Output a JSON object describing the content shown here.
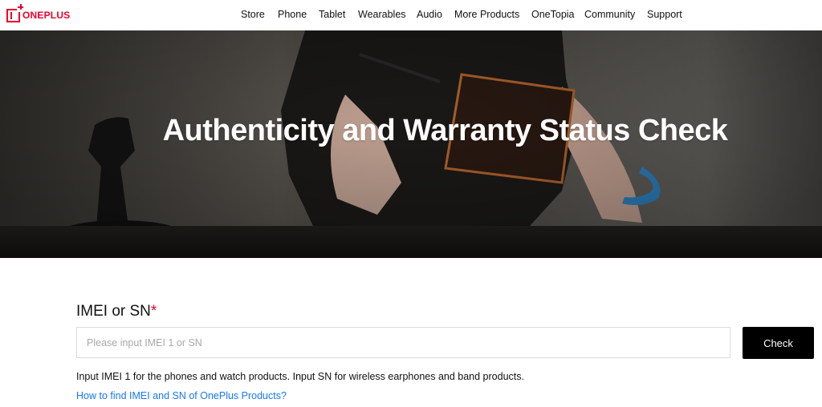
{
  "brand": {
    "name": "ONEPLUS",
    "color": "#eb0029"
  },
  "nav": {
    "items": [
      {
        "label": "Store"
      },
      {
        "label": "Phone"
      },
      {
        "label": "Tablet"
      },
      {
        "label": "Wearables"
      },
      {
        "label": "Audio"
      },
      {
        "label": "More Products"
      },
      {
        "label": "OneTopia"
      },
      {
        "label": "Community"
      },
      {
        "label": "Support"
      }
    ]
  },
  "hero": {
    "title": "Authenticity and Warranty Status Check"
  },
  "form": {
    "label": "IMEI or SN",
    "required_mark": "*",
    "placeholder": "Please input IMEI 1 or SN",
    "value": "",
    "button_label": "Check",
    "hint": "Input IMEI 1 for the phones and watch products. Input SN for wireless earphones and band products.",
    "help_link": "How to find IMEI and SN of OnePlus Products?"
  },
  "colors": {
    "accent": "#eb0029",
    "link": "#1677ff",
    "button_bg": "#000000"
  }
}
